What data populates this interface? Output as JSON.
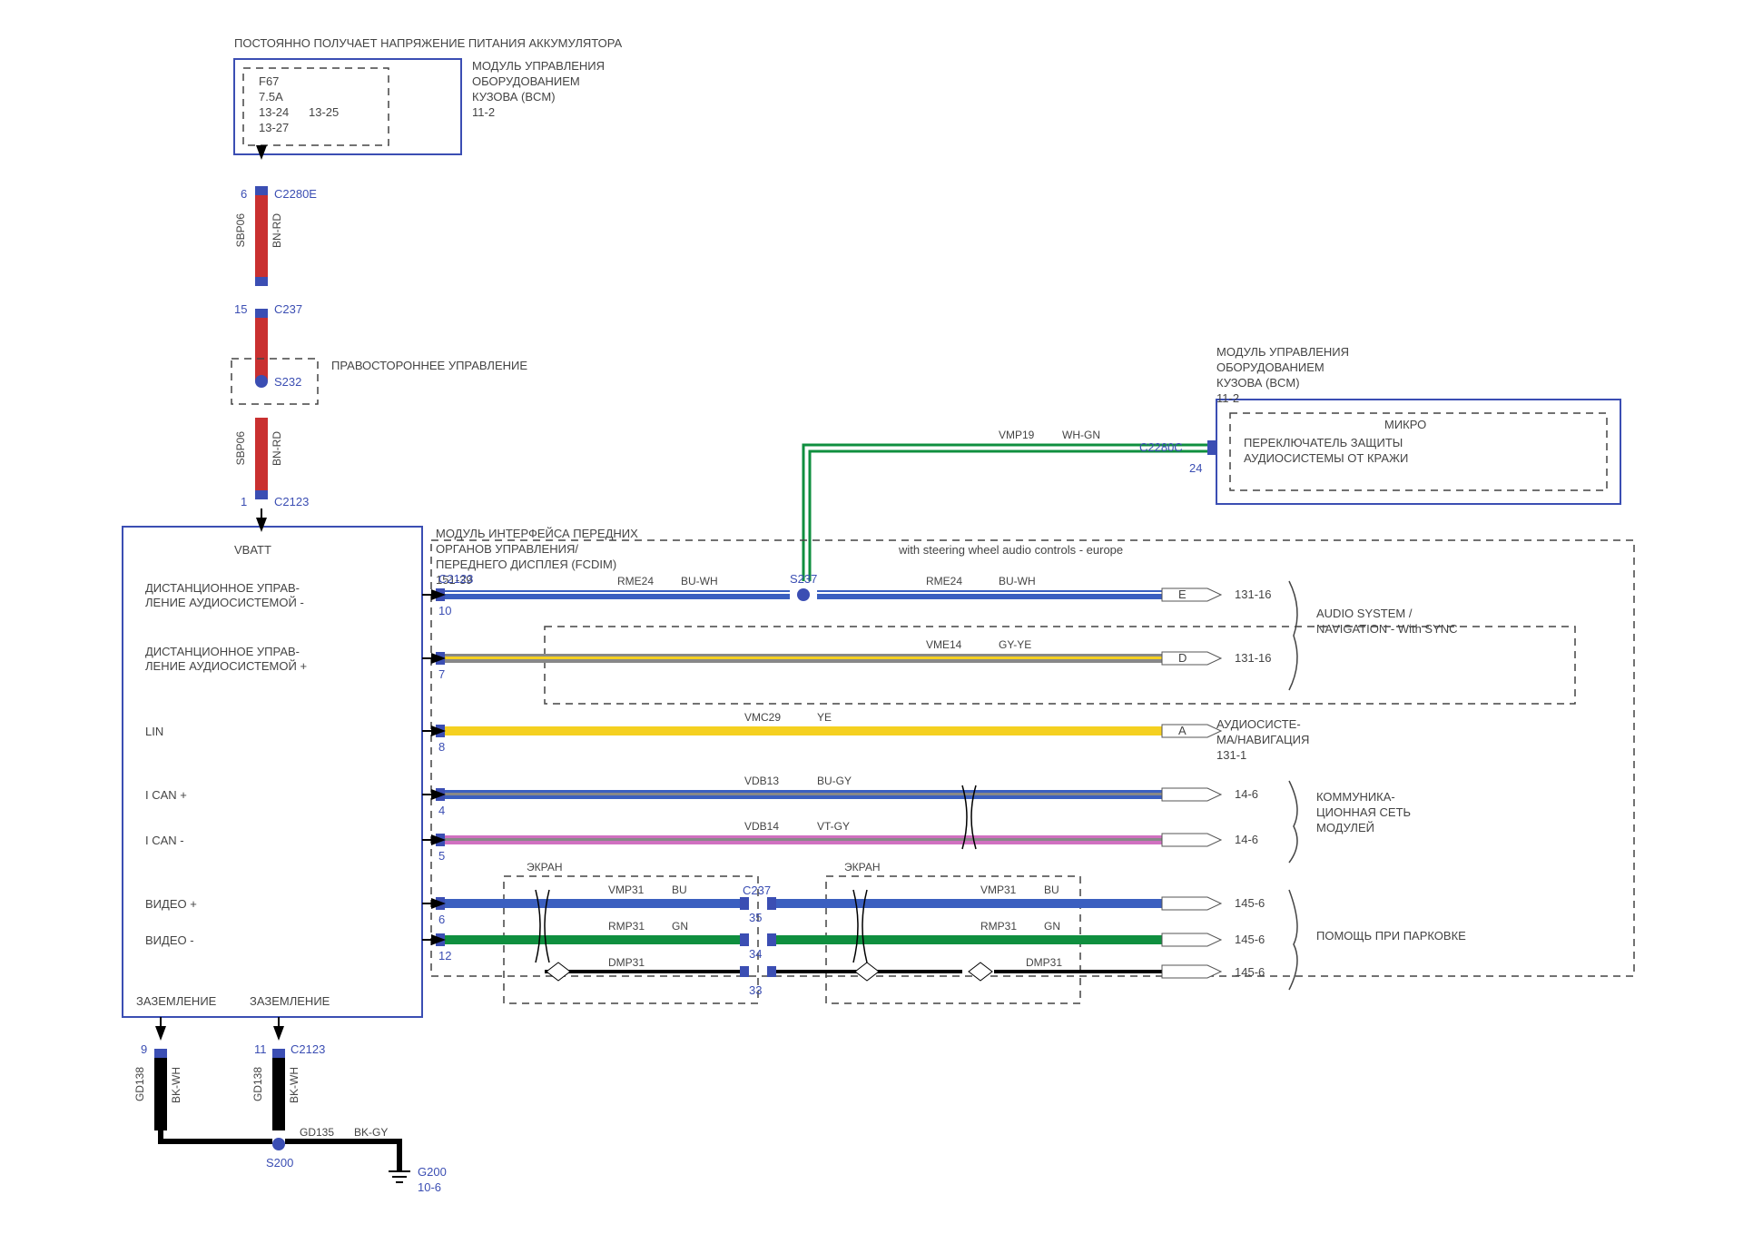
{
  "title_top": "ПОСТОЯННО ПОЛУЧАЕТ НАПРЯЖЕНИЕ ПИТАНИЯ АККУМУЛЯТОРА",
  "bcm_top": {
    "line1": "МОДУЛЬ УПРАВЛЕНИЯ",
    "line2": "ОБОРУДОВАНИЕМ",
    "line3": "КУЗОВА (BCM)",
    "ref": "11-2"
  },
  "fuse": {
    "name": "F67",
    "rating": "7.5A",
    "ref1": "13-24",
    "ref2": "13-25",
    "ref3": "13-27"
  },
  "connectors": {
    "c2280e": "C2280E",
    "pin6": "6",
    "c237": "C237",
    "pin15": "15",
    "s232": "S232",
    "c2123": "C2123",
    "pin1": "1",
    "pin9": "9",
    "pin11": "11",
    "s200": "S200",
    "g200": "G200",
    "g200_ref": "10-6",
    "c2280c": "C2280C",
    "pin24": "24",
    "s237": "S237",
    "pin10": "10",
    "pin7": "7",
    "pin8": "8",
    "pin4": "4",
    "pin5": "5",
    "pin6b": "6",
    "pin12": "12",
    "pin35": "35",
    "pin34": "34",
    "pin33": "33"
  },
  "wires": {
    "sbp06": "SBP06",
    "bn_rd": "BN-RD",
    "gd138": "GD138",
    "bk_wh": "BK-WH",
    "gd135": "GD135",
    "bk_gy": "BK-GY",
    "vmp19": "VMP19",
    "wh_gn": "WH-GN",
    "rme24": "RME24",
    "bu_wh": "BU-WH",
    "vme14": "VME14",
    "gy_ye": "GY-YE",
    "vmc29": "VMC29",
    "ye": "YE",
    "vdb13": "VDB13",
    "bu_gy": "BU-GY",
    "vdb14": "VDB14",
    "vt_gy": "VT-GY",
    "vmp31": "VMP31",
    "bu": "BU",
    "rmp31": "RMP31",
    "gn": "GN",
    "dmp31": "DMP31"
  },
  "rhd": "ПРАВОСТОРОННЕЕ УПРАВЛЕНИЕ",
  "fcdim": {
    "line1": "МОДУЛЬ ИНТЕРФЕЙСА ПЕРЕДНИХ",
    "line2": "ОРГАНОВ УПРАВЛЕНИЯ/",
    "line3": "ПЕРЕДНЕГО ДИСПЛЕЯ (FCDIM)",
    "ref": "151-39"
  },
  "fcdim_pins": {
    "vbatt": "VBATT",
    "remote_minus": "ДИСТАНЦИОННОЕ УПРАВ-",
    "remote_minus2": "ЛЕНИЕ АУДИОСИСТЕМОЙ -",
    "remote_plus": "ДИСТАНЦИОННОЕ УПРАВ-",
    "remote_plus2": "ЛЕНИЕ АУДИОСИСТЕМОЙ +",
    "lin": "LIN",
    "ican_p": "I CAN +",
    "ican_n": "I CAN -",
    "video_p": "ВИДЕО +",
    "video_n": "ВИДЕО -",
    "ground1": "ЗАЗЕМЛЕНИЕ",
    "ground2": "ЗАЗЕМЛЕНИЕ"
  },
  "bcm_right": {
    "line1": "МОДУЛЬ УПРАВЛЕНИЯ",
    "line2": "ОБОРУДОВАНИЕМ",
    "line3": "КУЗОВА (BCM)",
    "ref": "11-2",
    "micro": "МИКРО",
    "switch1": "ПЕРЕКЛЮЧАТЕЛЬ ЗАЩИТЫ",
    "switch2": "АУДИОСИСТЕМЫ ОТ КРАЖИ"
  },
  "options": {
    "swc": "with steering wheel audio controls - europe"
  },
  "refs": {
    "e": "E",
    "d": "D",
    "a": "A",
    "r131_16": "131-16",
    "r131_1": "131-1",
    "r14_6": "14-6",
    "r145_6": "145-6"
  },
  "dest_labels": {
    "audio_nav": "AUDIO SYSTEM /",
    "audio_nav2": "NAVIGATION - With SYNC",
    "audio_nav_ru1": "АУДИОСИСТЕ-",
    "audio_nav_ru2": "МА/НАВИГАЦИЯ",
    "comm1": "КОММУНИКА-",
    "comm2": "ЦИОННАЯ СЕТЬ",
    "comm3": "МОДУЛЕЙ",
    "park": "ПОМОЩЬ ПРИ ПАРКОВКЕ"
  },
  "screen": "ЭКРАН"
}
